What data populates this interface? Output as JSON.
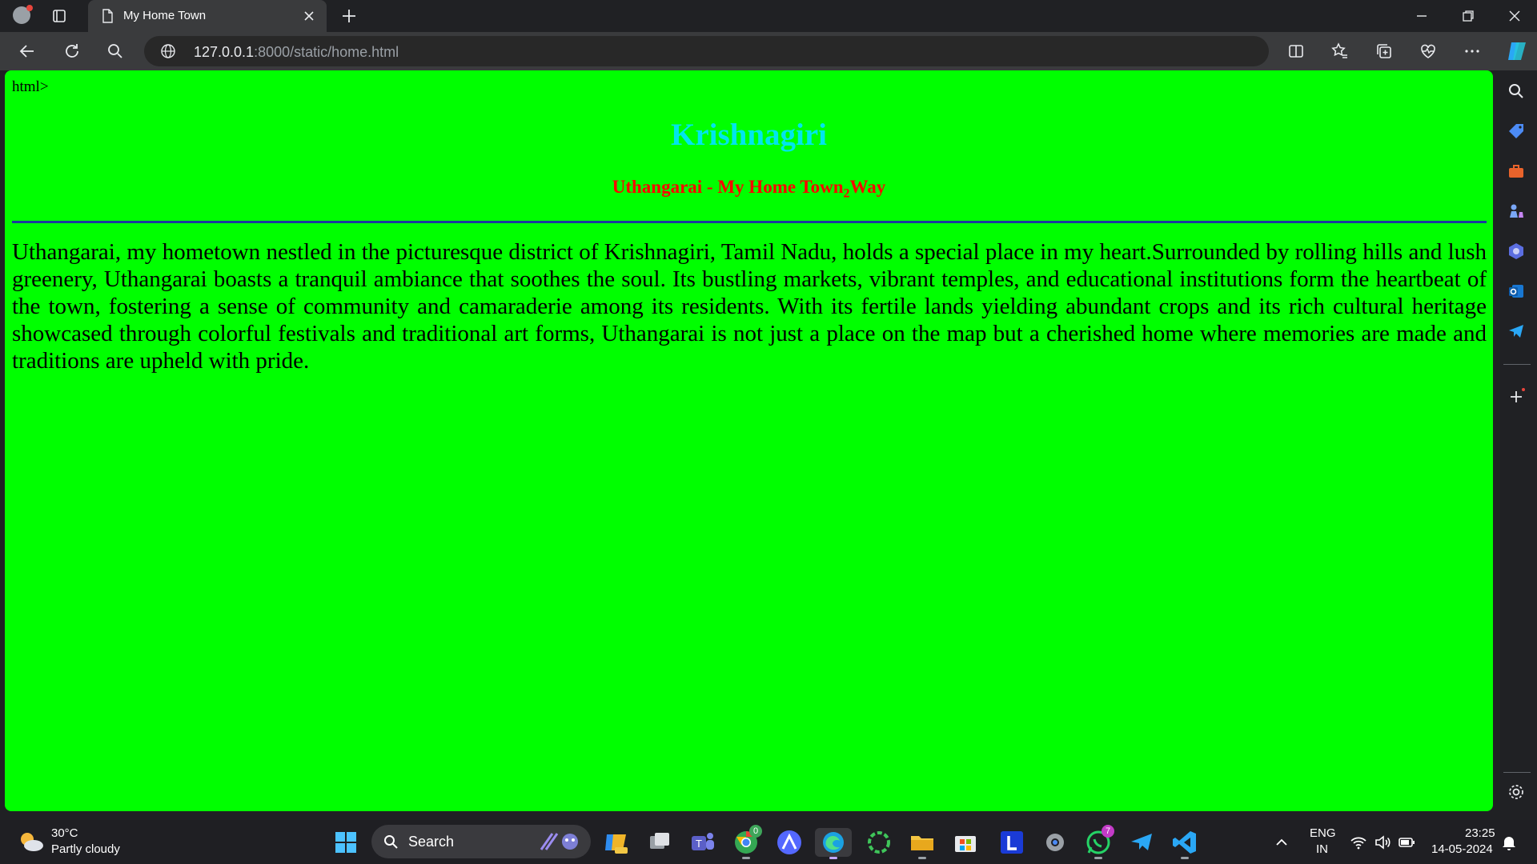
{
  "browser": {
    "tab_title": "My Home Town",
    "url_host": "127.0.0.1",
    "url_rest": ":8000/static/home.html"
  },
  "page": {
    "stray_text": "html>",
    "heading": "Krishnagiri",
    "subheading_main": "Uthangarai - My Home Town",
    "subheading_sub": "2",
    "subheading_tail": "Way",
    "paragraph": "Uthangarai, my hometown nestled in the picturesque district of Krishnagiri, Tamil Nadu, holds a special place in my heart.Surrounded by rolling hills and lush greenery, Uthangarai boasts a tranquil ambiance that soothes the soul. Its bustling markets, vibrant temples, and educational institutions form the heartbeat of the town, fostering a sense of community and camaraderie among its residents. With its fertile lands yielding abundant crops and its rich cultural heritage showcased through colorful festivals and traditional art forms, Uthangarai is not just a place on the map but a cherished home where memories are made and traditions are upheld with pride.",
    "background_color": "#00ff00",
    "heading_color": "#00e5ee",
    "subheading_color": "#ff0000",
    "rule_color": "#1a3aa0"
  },
  "taskbar": {
    "temperature": "30°C",
    "condition": "Partly cloudy",
    "search_label": "Search",
    "chrome_badge": "0",
    "whatsapp_badge": "7",
    "lang_line1": "ENG",
    "lang_line2": "IN",
    "time": "23:25",
    "date": "14-05-2024"
  }
}
